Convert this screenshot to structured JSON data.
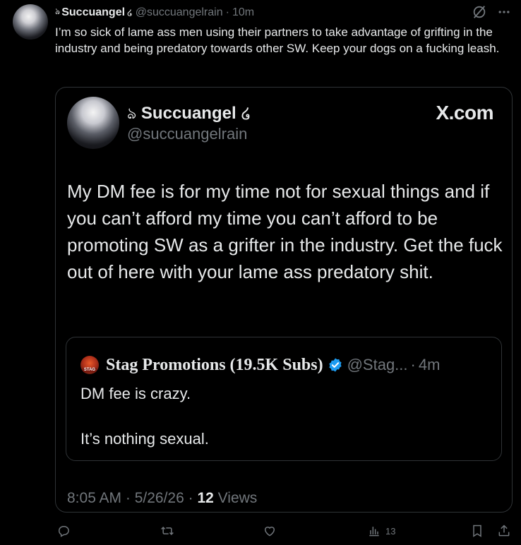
{
  "tweet": {
    "display_name": "Succuangel",
    "prefix_glyph": "ঌ",
    "suffix_glyph": "໒",
    "handle": "@succuangelrain",
    "separator": "·",
    "time": "10m",
    "text": "I’m so sick of lame ass men using their partners to take advantage of grifting in the industry and being predatory towards other SW. Keep your dogs on a fucking leash."
  },
  "top_icons": {
    "grok": "grok-icon",
    "more": "more-icon"
  },
  "card": {
    "display_name": "Succuangel",
    "prefix_glyph": "ঌ",
    "suffix_glyph": "໒",
    "handle": "@succuangelrain",
    "brand": "X.com",
    "text": "My DM fee is for my time not for sexual things and if you can’t afford my time you can’t afford to be promoting SW as a grifter in the industry. Get the fuck out of here with your lame ass predatory shit.",
    "quote": {
      "logo_text": "STAG",
      "name": "Stag Promotions (19.5K Subs)",
      "handle": "@Stag...",
      "separator": "·",
      "time": "4m",
      "line1": "DM fee is crazy.",
      "line2": "It’s nothing sexual."
    },
    "meta_time": "8:05 AM · 5/26/26 ·",
    "views_count": "12",
    "views_label": "Views"
  },
  "actions": {
    "views_count": "13"
  },
  "colors": {
    "background": "#000000",
    "text": "#e7e9ea",
    "muted": "#71767b",
    "border": "#2f3336",
    "verified": "#1d9bf0"
  }
}
